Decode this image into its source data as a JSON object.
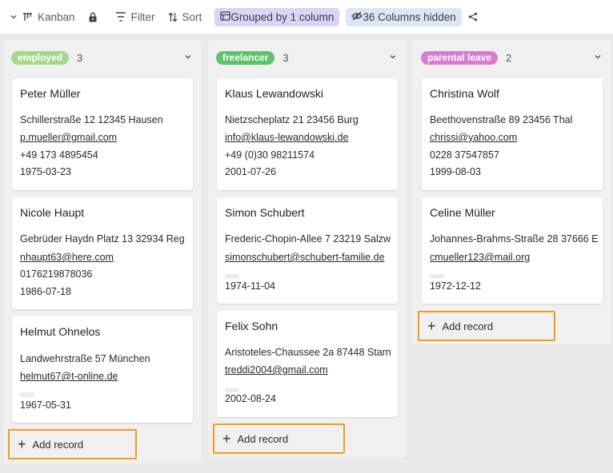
{
  "toolbar": {
    "view_label": "Kanban",
    "filter_label": "Filter",
    "sort_label": "Sort",
    "grouped_label": "Grouped by 1 column",
    "hidden_label": "36 Columns hidden"
  },
  "colors": {
    "employed": "#a5d88a",
    "freelancer": "#5cc26b",
    "parental_leave": "#d77cd1",
    "highlight": "#f39a1d"
  },
  "columns": [
    {
      "label": "employed",
      "count": "3",
      "add_label": "Add record",
      "cards": [
        {
          "name": "Peter Müller",
          "address": "Schillerstraße 12 12345 Hausen",
          "email": "p.mueller@gmail.com",
          "phone": "+49 173 4895454",
          "date": "1975-03-23"
        },
        {
          "name": "Nicole Haupt",
          "address": "Gebrüder Haydn Platz 13 32934 Reg",
          "email": "nhaupt63@here.com",
          "phone": "0176219878036",
          "date": "1986-07-18"
        },
        {
          "name": "Helmut Ohnelos",
          "address": "Landwehrstraße 57 München",
          "email": "helmut67@t-online.de",
          "phone": "",
          "date": "1967-05-31"
        }
      ]
    },
    {
      "label": "freelancer",
      "count": "3",
      "add_label": "Add record",
      "cards": [
        {
          "name": "Klaus Lewandowski",
          "address": "Nietzscheplatz 21 23456 Burg",
          "email": "info@klaus-lewandowski.de",
          "phone": "+49 (0)30 98211574",
          "date": "2001-07-26"
        },
        {
          "name": "Simon Schubert",
          "address": "Frederic-Chopin-Allee 7 23219 Salzw",
          "email": "simonschubert@schubert-familie.de",
          "phone": "",
          "date": "1974-11-04"
        },
        {
          "name": "Felix Sohn",
          "address": "Aristoteles-Chaussee 2a 87448 Starn",
          "email": "treddi2004@gmail.com",
          "phone": "",
          "date": "2002-08-24"
        }
      ]
    },
    {
      "label": "parental leave",
      "count": "2",
      "add_label": "Add record",
      "cards": [
        {
          "name": "Christina Wolf",
          "address": "Beethovenstraße 89 23456 Thal",
          "email": "chrissi@yahoo.com",
          "phone": "0228 37547857",
          "date": "1999-08-03"
        },
        {
          "name": "Celine Müller",
          "address": "Johannes-Brahms-Straße 28 37666 E",
          "email": "cmueller123@mail.org",
          "phone": "",
          "date": "1972-12-12"
        }
      ]
    }
  ]
}
